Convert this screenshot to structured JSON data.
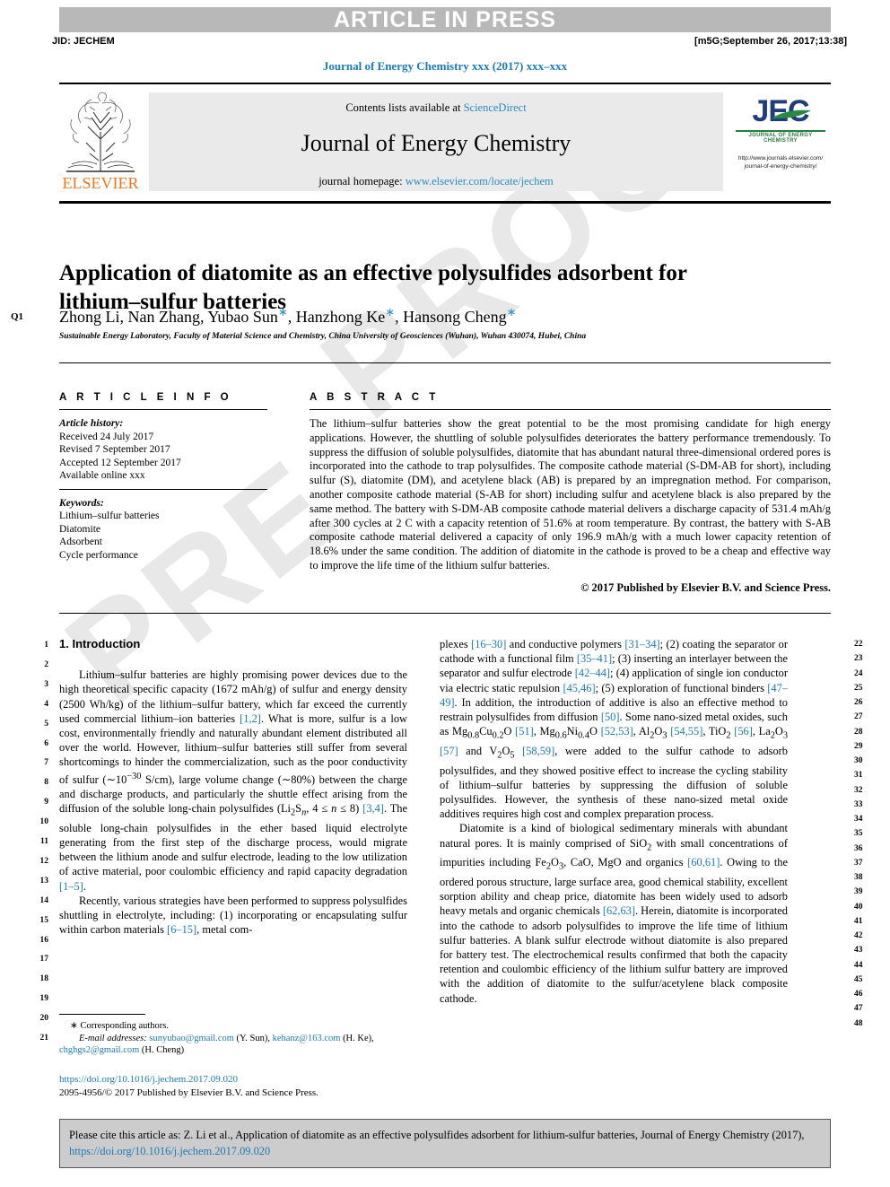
{
  "header": {
    "article_in_press": "ARTICLE IN PRESS",
    "jid": "JID: JECHEM",
    "stamp": "[m5G;September 26, 2017;13:38]",
    "journal_ref": "Journal of Energy Chemistry xxx (2017) xxx–xxx"
  },
  "masthead": {
    "contents_prefix": "Contents lists available at ",
    "sciencedirect": "ScienceDirect",
    "journal_title": "Journal of Energy Chemistry",
    "homepage_prefix": "journal homepage: ",
    "homepage_url": "www.elsevier.com/locate/jechem",
    "elsevier_label": "ELSEVIER",
    "jec_logo_text": "JEC",
    "jec_logo_sub": "JOURNAL OF ENERGY CHEMISTRY",
    "jec_url_line1": "http://www.journals.elsevier.com/",
    "jec_url_line2": "journal-of-energy-chemistry/"
  },
  "article": {
    "query_marker": "Q1",
    "title": "Application of diatomite as an effective polysulfides adsorbent for lithium–sulfur batteries",
    "authors_plain": "Zhong Li, Nan Zhang, Yubao Sun",
    "authors": [
      {
        "name": "Zhong Li",
        "star": false
      },
      {
        "name": "Nan Zhang",
        "star": false
      },
      {
        "name": "Yubao Sun",
        "star": true
      },
      {
        "name": "Hanzhong Ke",
        "star": true
      },
      {
        "name": "Hansong Cheng",
        "star": true
      }
    ],
    "affiliation": "Sustainable Energy Laboratory, Faculty of Material Science and Chemistry, China University of Geosciences (Wuhan), Wuhan 430074, Hubei, China"
  },
  "article_info": {
    "heading": "A R T I C L E   I N F O",
    "history_label": "Article history:",
    "history": [
      "Received 24 July 2017",
      "Revised 7 September 2017",
      "Accepted 12 September 2017",
      "Available online xxx"
    ],
    "keywords_label": "Keywords:",
    "keywords": [
      "Lithium–sulfur batteries",
      "Diatomite",
      "Adsorbent",
      "Cycle performance"
    ]
  },
  "abstract": {
    "heading": "A B S T R A C T",
    "text": "The lithium–sulfur batteries show the great potential to be the most promising candidate for high energy applications. However, the shuttling of soluble polysulfides deteriorates the battery performance tremendously. To suppress the diffusion of soluble polysulfides, diatomite that has abundant natural three-dimensional ordered pores is incorporated into the cathode to trap polysulfides. The composite cathode material (S-DM-AB for short), including sulfur (S), diatomite (DM), and acetylene black (AB) is prepared by an impregnation method. For comparison, another composite cathode material (S-AB for short) including sulfur and acetylene black is also prepared by the same method. The battery with S-DM-AB composite cathode material delivers a discharge capacity of 531.4 mAh/g after 300 cycles at 2 C with a capacity retention of 51.6% at room temperature. By contrast, the battery with S-AB composite cathode material delivered a capacity of only 196.9 mAh/g with a much lower capacity retention of 18.6% under the same condition. The addition of diatomite in the cathode is proved to be a cheap and effective way to improve the life time of the lithium sulfur batteries.",
    "copyright": "© 2017 Published by Elsevier B.V. and Science Press."
  },
  "body": {
    "section_title": "1. Introduction",
    "left_paragraphs": [
      "Lithium–sulfur batteries are highly promising power devices due to the high theoretical specific capacity (1672 mAh/g) of sulfur and energy density (2500 Wh/kg) of the lithium–sulfur battery, which far exceed the currently used commercial lithium–ion batteries [1,2]. What is more, sulfur is a low cost, environmentally friendly and naturally abundant element distributed all over the world. However, lithium–sulfur batteries still suffer from several shortcomings to hinder the commercialization, such as the poor conductivity of sulfur (~10−30 S/cm), large volume change (~80%) between the charge and discharge products, and particularly the shuttle effect arising from the diffusion of the soluble long-chain polysulfides (Li2Sn, 4 ≤ n ≤ 8) [3,4]. The soluble long-chain polysulfides in the ether based liquid electrolyte generating from the first step of the discharge process, would migrate between the lithium anode and sulfur electrode, leading to the low utilization of active material, poor coulombic efficiency and rapid capacity degradation [1–5].",
      "Recently, various strategies have been performed to suppress polysulfides shuttling in electrolyte, including: (1) incorporating or encapsulating sulfur within carbon materials [6–15], metal com-"
    ],
    "right_paragraphs": [
      "plexes [16–30] and conductive polymers [31–34]; (2) coating the separator or cathode with a functional film [35–41]; (3) inserting an interlayer between the separator and sulfur electrode [42–44]; (4) application of single ion conductor via electric static repulsion [45,46]; (5) exploration of functional binders [47–49]. In addition, the introduction of additive is also an effective method to restrain polysulfides from diffusion [50]. Some nano-sized metal oxides, such as Mg0.8Cu0.2O [51], Mg0.6Ni0.4O [52,53], Al2O3 [54,55], TiO2 [56], La2O3 [57] and V2O5 [58,59], were added to the sulfur cathode to adsorb polysulfides, and they showed positive effect to increase the cycling stability of lithium–sulfur batteries by suppressing the diffusion of soluble polysulfides. However, the synthesis of these nano-sized metal oxide additives requires high cost and complex preparation process.",
      "Diatomite is a kind of biological sedimentary minerals with abundant natural pores. It is mainly comprised of SiO2 with small concentrations of impurities including Fe2O3, CaO, MgO and organics [60,61]. Owing to the ordered porous structure, large surface area, good chemical stability, excellent sorption ability and cheap price, diatomite has been widely used to adsorb heavy metals and organic chemicals [62,63]. Herein, diatomite is incorporated into the cathode to adsorb polysulfides to improve the life time of lithium sulfur batteries. A blank sulfur electrode without diatomite is also prepared for battery test. The electrochemical results confirmed that both the capacity retention and coulombic efficiency of the lithium sulfur battery are improved with the addition of diatomite to the sulfur/acetylene black composite cathode."
    ],
    "left_line_numbers": [
      "1",
      "2",
      "3",
      "4",
      "5",
      "6",
      "7",
      "8",
      "9",
      "10",
      "11",
      "12",
      "13",
      "14",
      "15",
      "16",
      "17",
      "18",
      "19",
      "20",
      "21"
    ],
    "right_line_numbers": [
      "22",
      "23",
      "24",
      "25",
      "26",
      "27",
      "28",
      "29",
      "30",
      "31",
      "32",
      "33",
      "34",
      "35",
      "36",
      "37",
      "38",
      "39",
      "40",
      "41",
      "42",
      "43",
      "44",
      "45",
      "46",
      "47",
      "48"
    ]
  },
  "footnote": {
    "corresponding": "Corresponding authors.",
    "email_label": "E-mail addresses:",
    "emails": [
      {
        "address": "sunyubao@gmail.com",
        "who": "(Y. Sun)"
      },
      {
        "address": "kehanz@163.com",
        "who": "(H. Ke)"
      },
      {
        "address": "chghgs2@gmail.com",
        "who": "(H. Cheng)"
      }
    ],
    "doi": "https://doi.org/10.1016/j.jechem.2017.09.020",
    "issn_line": "2095-4956/© 2017 Published by Elsevier B.V. and Science Press."
  },
  "citation": {
    "prefix": "Please cite this article as: Z. Li et al., Application of diatomite as an effective polysulfides adsorbent for lithium-sulfur batteries, Journal of Energy Chemistry (2017), ",
    "link": "https://doi.org/10.1016/j.jechem.2017.09.020"
  },
  "colors": {
    "link": "#1c7ab5",
    "elsevier_orange": "#e87722",
    "jec_blue": "#1f3d7a",
    "jec_green": "#2a7b40",
    "band_gray": "#b8b8b8",
    "cite_gray": "#cccccc"
  },
  "watermark": {
    "line1": "PROO",
    "line2": "PRE"
  }
}
